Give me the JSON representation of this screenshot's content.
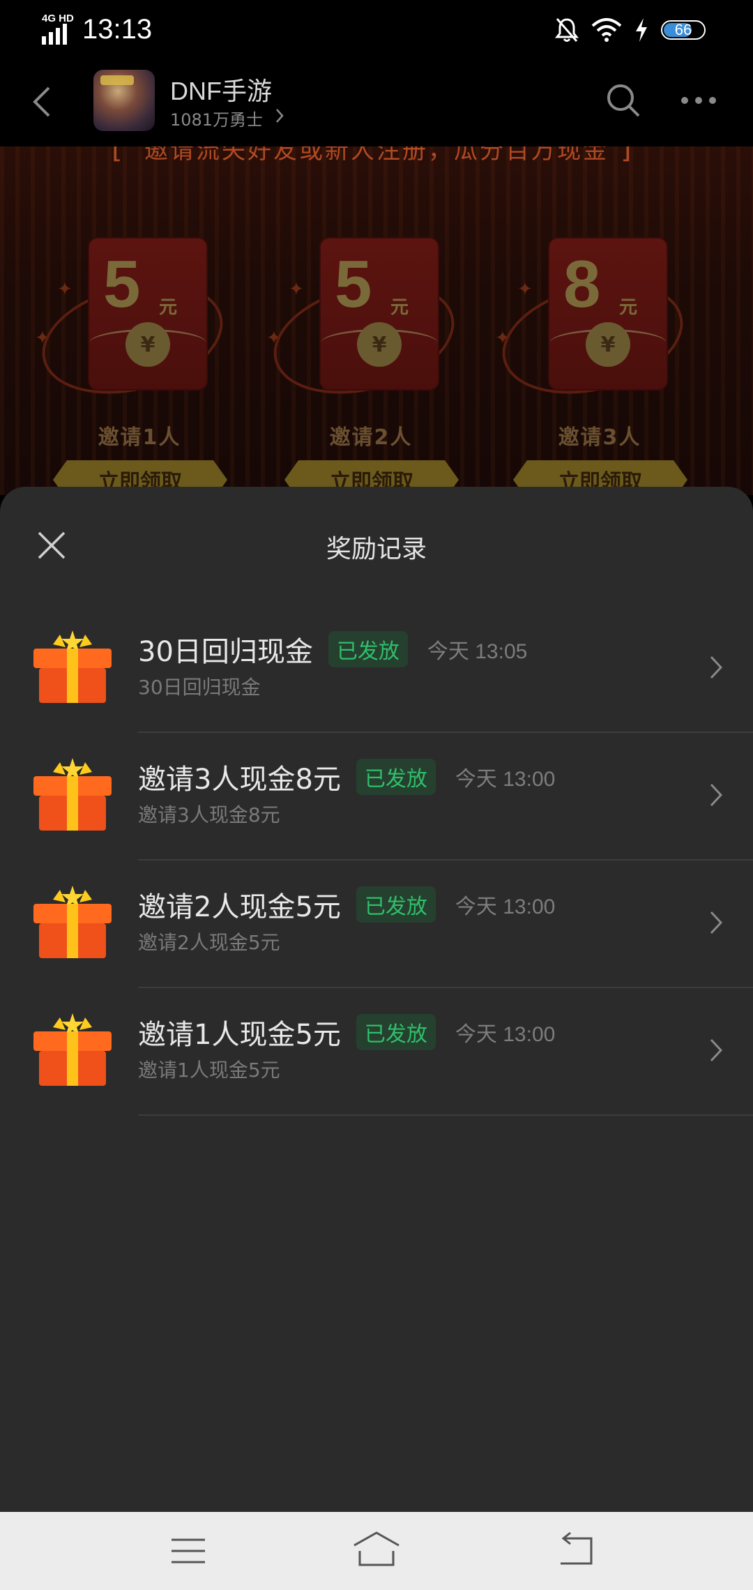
{
  "status_bar": {
    "network": "4G HD",
    "time": "13:13",
    "battery": "66",
    "icons": [
      "mute-bell-icon",
      "wifi-icon",
      "charging-bolt-icon",
      "battery-icon"
    ]
  },
  "header": {
    "forum_name": "DNF手游",
    "members": "1081万勇士"
  },
  "banner": {
    "tagline": "邀请流失好友或新人注册，瓜分百万现金",
    "cards": [
      {
        "amount": "5",
        "unit": "元",
        "label": "邀请1人",
        "button": "立即领取"
      },
      {
        "amount": "5",
        "unit": "元",
        "label": "邀请2人",
        "button": "立即领取"
      },
      {
        "amount": "8",
        "unit": "元",
        "label": "邀请3人",
        "button": "立即领取"
      }
    ]
  },
  "sheet": {
    "title": "奖励记录",
    "records": [
      {
        "title": "30日回归现金",
        "status": "已发放",
        "time": "今天 13:05",
        "subtitle": "30日回归现金"
      },
      {
        "title": "邀请3人现金8元",
        "status": "已发放",
        "time": "今天 13:00",
        "subtitle": "邀请3人现金8元"
      },
      {
        "title": "邀请2人现金5元",
        "status": "已发放",
        "time": "今天 13:00",
        "subtitle": "邀请2人现金5元"
      },
      {
        "title": "邀请1人现金5元",
        "status": "已发放",
        "time": "今天 13:00",
        "subtitle": "邀请1人现金5元"
      }
    ]
  },
  "colors": {
    "sheet_background": "#2b2b2b",
    "badge_text": "#2fbf6a",
    "badge_background": "#25402f"
  }
}
